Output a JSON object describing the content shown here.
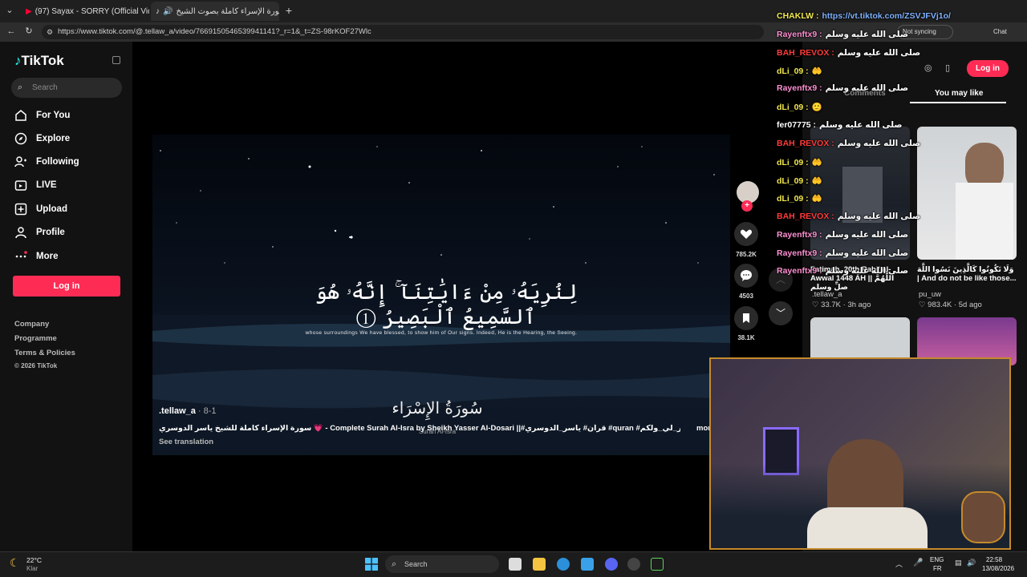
{
  "browser": {
    "tabs": [
      {
        "label": "(97) Sayax - SORRY (Official Video)"
      },
      {
        "label": "سورة الإسراء كاملة بصوت الشيخ"
      }
    ],
    "url": "https://www.tiktok.com/@.tellaw_a/video/7669150546539941141?_r=1&_t=ZS-98rKOF27Wlc",
    "sync_label": "Not syncing",
    "chat_label": "Chat"
  },
  "sidebar": {
    "logo": "TikTok",
    "search_placeholder": "Search",
    "items": [
      {
        "label": "For You"
      },
      {
        "label": "Explore"
      },
      {
        "label": "Following"
      },
      {
        "label": "LIVE"
      },
      {
        "label": "Upload"
      },
      {
        "label": "Profile"
      },
      {
        "label": "More"
      }
    ],
    "login": "Log in",
    "footer": [
      "Company",
      "Programme",
      "Terms & Policies",
      "© 2026 TikTok"
    ]
  },
  "video": {
    "arabic_verse": "لِنُرِيَهُۥ مِنْ ءَايَٰتِنَآ ۚ إِنَّهُۥ هُوَ ٱلسَّمِيعُ ٱلْبَصِيرُ ①",
    "translation": "whose surroundings We have blessed, to show him of Our signs. Indeed, He is the Hearing, the Seeing.",
    "surah_title": "سُورَةُ الإِسْرَاء",
    "surah_sub": "Surah Al-Isra",
    "author": ".tellaw_a",
    "date": "8-1",
    "description": "سورة الإسراء كاملة للشيخ ياسر الدوسري 💗 - Complete Surah Al-Isra by Sheikh Yasser Al-Dosari ||#قرآن# ياسر_الدوسري #quran #اجر_لي_ولكم #islamic_video",
    "see_translation": "See translation",
    "more": "more"
  },
  "rail": {
    "likes": "785.2K",
    "comments": "4503",
    "saves": "38.1K"
  },
  "right_panel": {
    "login": "Log in",
    "tabs": [
      "Comments",
      "You may like"
    ],
    "cards": [
      {
        "title": "Fatimah, 20th Rabi' al-Awwal 1448 AH || اللَّهُمَّ صلِّ وسلم",
        "author": ".tellaw_a",
        "views": "33.7K",
        "age": "3h ago"
      },
      {
        "title": "وَلَا تَكُونُوا كَالَّذِينَ نَسُوا اللَّهَ | And do not be like those...",
        "author": "pu_uw",
        "views": "983.4K",
        "age": "5d ago"
      }
    ]
  },
  "chat": [
    {
      "user": "CHAKLW",
      "msg": "https://vt.tiktok.com/ZSVJFVj1o/",
      "color": "#f2e84b"
    },
    {
      "user": "Rayenftx9",
      "msg": "صلى الله عليه وسلم",
      "color": "#ff8fd2"
    },
    {
      "user": "BAH_REVOX",
      "msg": "صلى الله عليه وسلم",
      "color": "#ff3b3b"
    },
    {
      "user": "dLi_09",
      "msg": "🤲",
      "color": "#f2e84b"
    },
    {
      "user": "Rayenftx9",
      "msg": "صلى الله عليه وسلم",
      "color": "#ff8fd2"
    },
    {
      "user": "dLi_09",
      "msg": "🙂",
      "color": "#f2e84b"
    },
    {
      "user": "fer07775",
      "msg": "صلى الله عليه وسلم",
      "color": "#ffffff"
    },
    {
      "user": "BAH_REVOX",
      "msg": "صلى الله عليه وسلم",
      "color": "#ff3b3b"
    },
    {
      "user": "dLi_09",
      "msg": "🤲",
      "color": "#f2e84b"
    },
    {
      "user": "dLi_09",
      "msg": "🤲",
      "color": "#f2e84b"
    },
    {
      "user": "dLi_09",
      "msg": "🤲",
      "color": "#f2e84b"
    },
    {
      "user": "BAH_REVOX",
      "msg": "صلى الله عليه وسلم",
      "color": "#ff3b3b"
    },
    {
      "user": "Rayenftx9",
      "msg": "صلى الله عليه وسلم",
      "color": "#ff8fd2"
    },
    {
      "user": "Rayenftx9",
      "msg": "صلى الله عليه وسلم",
      "color": "#ff8fd2"
    },
    {
      "user": "Rayenftx9",
      "msg": "صلى الله عليه وسلم",
      "color": "#ff8fd2"
    }
  ],
  "taskbar": {
    "weather_temp": "22°C",
    "weather_desc": "Klar",
    "search": "Search",
    "lang_top": "ENG",
    "lang_bot": "FR",
    "time": "22:58",
    "date": "13/08/2026"
  },
  "colors": {
    "accent": "#fe2c55",
    "background": "#121212"
  }
}
